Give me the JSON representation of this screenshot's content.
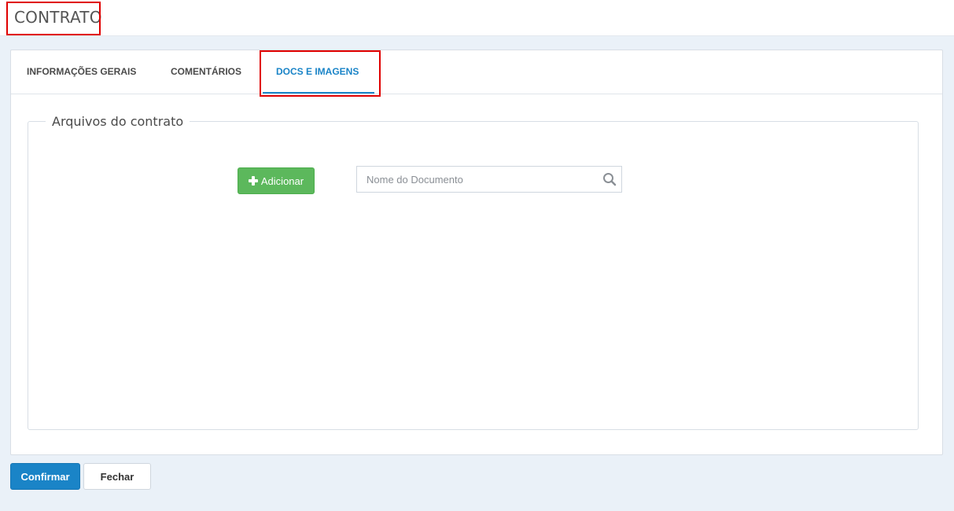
{
  "header": {
    "title": "CONTRATO"
  },
  "tabs": [
    {
      "label": "INFORMAÇÕES GERAIS",
      "active": false
    },
    {
      "label": "COMENTÁRIOS",
      "active": false
    },
    {
      "label": "DOCS E IMAGENS",
      "active": true
    }
  ],
  "files_section": {
    "legend": "Arquivos do contrato",
    "add_button_label": "Adicionar",
    "add_button_icon": "plus-icon",
    "search_placeholder": "Nome do Documento",
    "search_value": "",
    "search_icon": "search-icon"
  },
  "footer": {
    "confirm_label": "Confirmar",
    "close_label": "Fechar"
  },
  "colors": {
    "accent": "#1a84c7",
    "success": "#5cb85c",
    "highlight": "#e00000",
    "background": "#eaf1f8"
  }
}
